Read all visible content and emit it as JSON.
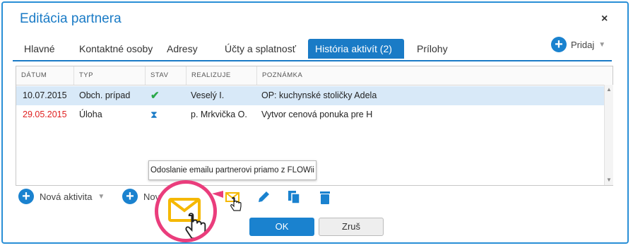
{
  "dialog": {
    "title": "Editácia partnera",
    "close_label": "×"
  },
  "tabs": [
    {
      "label": "Hlavné"
    },
    {
      "label": "Kontaktné osoby"
    },
    {
      "label": "Adresy"
    },
    {
      "label": "Účty a splatnosť"
    },
    {
      "label": "História aktivít (2)",
      "active": true
    },
    {
      "label": "Prílohy"
    }
  ],
  "add_button": {
    "label": "Pridaj"
  },
  "grid": {
    "columns": [
      "DÁTUM",
      "TYP",
      "STAV",
      "REALIZUJE",
      "POZNÁMKA"
    ],
    "rows": [
      {
        "date": "10.07.2015",
        "type": "Obch. prípad",
        "status": "done",
        "status_icon": "✔",
        "realizer": "Veselý I.",
        "note": "OP: kuchynské stoličky Adela",
        "selected": true,
        "date_color": "#222222"
      },
      {
        "date": "29.05.2015",
        "type": "Úloha",
        "status": "pending",
        "status_icon": "⧗",
        "realizer": "p. Mrkvička O.",
        "note": "Vytvor cenová ponuka pre H",
        "selected": false,
        "date_color": "#e02020"
      }
    ]
  },
  "tooltip": {
    "text": "Odoslanie emailu partnerovi priamo z FLOWii"
  },
  "toolbar": {
    "new_activity_label": "Nová aktivita",
    "new_partial_label": "Nov",
    "icons": [
      "mail-icon",
      "edit-icon",
      "copy-icon",
      "trash-icon"
    ]
  },
  "buttons": {
    "ok": "OK",
    "cancel": "Zruš"
  },
  "colors": {
    "accent": "#1a7bc6",
    "overdue": "#e02020",
    "done": "#2aa84a",
    "highlight": "#ea3d7c",
    "mail": "#f5b800"
  }
}
